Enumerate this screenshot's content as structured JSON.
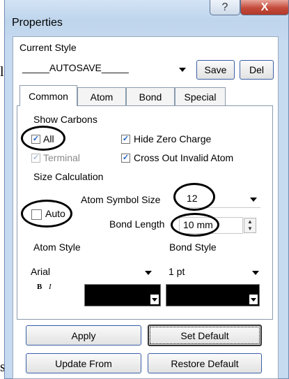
{
  "window": {
    "title": "Properties",
    "help_label": "?",
    "close_label": "X"
  },
  "background_text": {
    "left_top": "l",
    "left_bottom": "s"
  },
  "style": {
    "current_label": "Current Style",
    "selected": "_____AUTOSAVE_____",
    "save_label": "Save",
    "del_label": "Del"
  },
  "tabs": [
    {
      "label": "Common",
      "active": true
    },
    {
      "label": "Atom",
      "active": false
    },
    {
      "label": "Bond",
      "active": false
    },
    {
      "label": "Special",
      "active": false
    }
  ],
  "show_carbons": {
    "heading": "Show Carbons",
    "all": {
      "label": "All",
      "checked": true
    },
    "terminal": {
      "label": "Terminal",
      "checked": true,
      "disabled": true
    },
    "hide_zero_charge": {
      "label": "Hide Zero Charge",
      "checked": true
    },
    "cross_out_invalid_atom": {
      "label": "Cross Out Invalid Atom",
      "checked": true
    }
  },
  "size_calculation": {
    "heading": "Size Calculation",
    "auto": {
      "label": "Auto",
      "checked": false
    },
    "atom_symbol_size_label": "Atom Symbol Size",
    "atom_symbol_size_value": "12",
    "bond_length_label": "Bond Length",
    "bond_length_value": "10 mm"
  },
  "atom_style": {
    "heading": "Atom Style",
    "font": "Arial",
    "bold_label": "B",
    "italic_label": "I",
    "color": "#000000"
  },
  "bond_style": {
    "heading": "Bond Style",
    "width": "1 pt",
    "color": "#000000"
  },
  "buttons": {
    "apply": "Apply",
    "set_default": "Set Default",
    "update_from": "Update From",
    "restore_default": "Restore Default"
  },
  "colors": {
    "accent_blue": "#1d5fbf",
    "close_red": "#c44a3a",
    "annotation_ring": "#000000"
  }
}
